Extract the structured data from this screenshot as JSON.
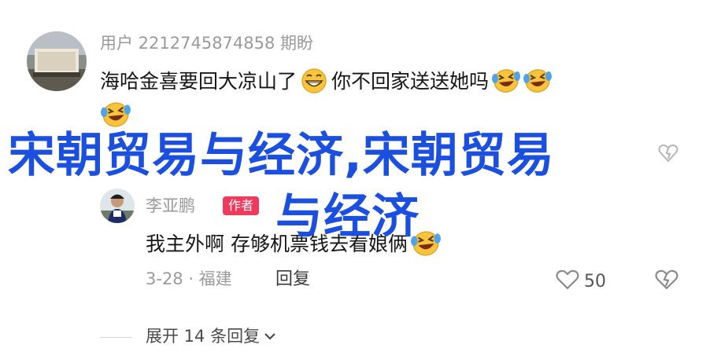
{
  "comment1": {
    "username": "用户 2212745874858 期盼",
    "text_part1": "海哈金喜要回大凉山了",
    "text_part2": "你不回家送送她吗",
    "emoji_grin": "grinning-face",
    "emoji_laugh": "laughing-tears-face"
  },
  "comment2": {
    "username": "李亚鹏",
    "badge": "作者",
    "text": "我主外啊 存够机票钱去看娘俩",
    "date": "3-28 · 福建",
    "reply_label": "回复",
    "like_count": "50"
  },
  "expand": {
    "label": "展开 14 条回复"
  },
  "overlay": {
    "line1": "宋朝贸易与经济,宋朝贸易",
    "line2": "与经济"
  },
  "colors": {
    "overlay_text": "#1a4fe0",
    "badge_bg": "#f03a5c",
    "meta_gray": "#9a9a9a"
  }
}
